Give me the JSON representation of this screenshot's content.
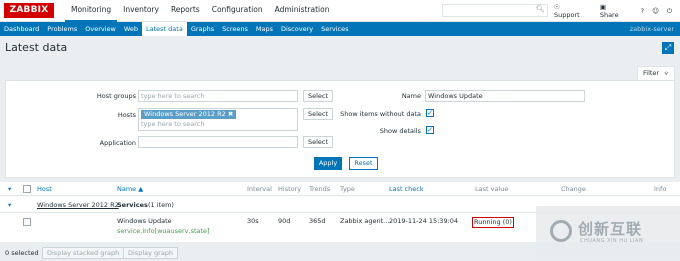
{
  "logo": "ZABBIX",
  "main_menu": [
    "Monitoring",
    "Inventory",
    "Reports",
    "Configuration",
    "Administration"
  ],
  "top_links": {
    "support": "Support",
    "share": "Share",
    "help": "?"
  },
  "sub_menu": [
    "Dashboard",
    "Problems",
    "Overview",
    "Web",
    "Latest data",
    "Graphs",
    "Screens",
    "Maps",
    "Discovery",
    "Services"
  ],
  "server_name": "zabbix-server",
  "page_title": "Latest data",
  "filter": {
    "tab_label": "Filter",
    "host_groups_label": "Host groups",
    "host_groups_placeholder": "type here to search",
    "hosts_label": "Hosts",
    "hosts_tag": "Windows Server 2012 R2",
    "hosts_placeholder": "type here to search",
    "application_label": "Application",
    "select_label": "Select",
    "name_label": "Name",
    "name_value": "Windows Update",
    "show_items_label": "Show items without data",
    "show_details_label": "Show details",
    "apply_label": "Apply",
    "reset_label": "Reset"
  },
  "table": {
    "headers": {
      "host": "Host",
      "name": "Name ▲",
      "interval": "Interval",
      "history": "History",
      "trends": "Trends",
      "type": "Type",
      "last_check": "Last check",
      "last_value": "Last value",
      "change": "Change",
      "info": "Info"
    },
    "group": {
      "host": "Windows Server 2012 R2",
      "app": "Services",
      "count": "(1 item)"
    },
    "row": {
      "name": "Windows Update",
      "key": "service.info[wuauserv,state]",
      "interval": "30s",
      "history": "90d",
      "trends": "365d",
      "type": "Zabbix agent...",
      "last_check": "2019-11-24 15:39:04",
      "last_value": "Running (0)"
    }
  },
  "footer": {
    "selected": "0 selected",
    "stacked_graph": "Display stacked graph",
    "graph": "Display graph"
  },
  "watermark": {
    "title": "创新互联",
    "sub": "CHUANG XIN HU LIAN"
  }
}
